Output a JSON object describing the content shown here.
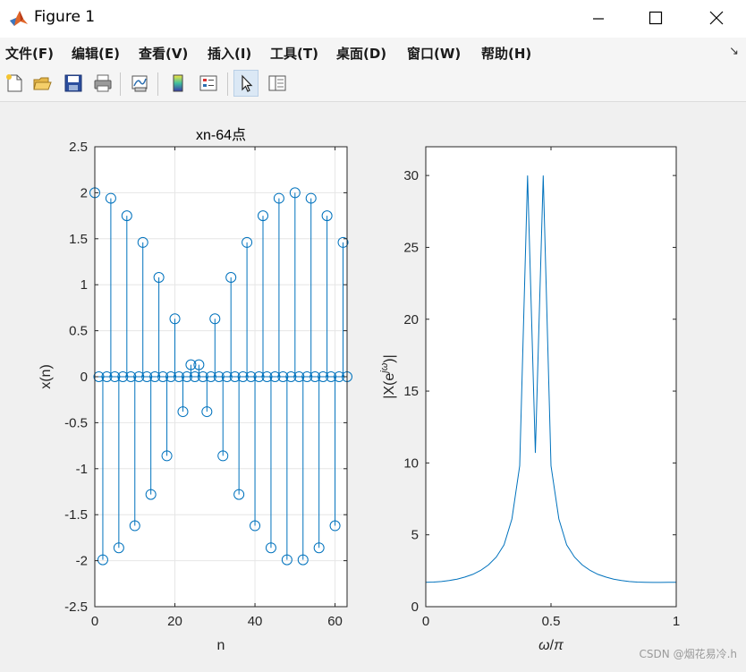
{
  "window": {
    "title": "Figure 1"
  },
  "menu": [
    "文件(F)",
    "编辑(E)",
    "查看(V)",
    "插入(I)",
    "工具(T)",
    "桌面(D)",
    "窗口(W)",
    "帮助(H)"
  ],
  "toolbar": [
    {
      "icon": "new-file-icon"
    },
    {
      "icon": "open-folder-icon"
    },
    {
      "icon": "save-icon"
    },
    {
      "icon": "print-icon"
    },
    {
      "icon": "link-plot-icon"
    },
    {
      "icon": "colorbar-icon"
    },
    {
      "icon": "legend-icon"
    },
    {
      "icon": "pointer-icon",
      "active": true
    },
    {
      "icon": "property-editor-icon"
    }
  ],
  "colors": {
    "series": "#0072bd",
    "grid": "#e6e6e6",
    "axes": "#262626"
  },
  "chart_data": [
    {
      "type": "scatter",
      "style": "stem",
      "title": "xn-64点",
      "xlabel": "n",
      "ylabel": "x(n)",
      "xlim": [
        0,
        63
      ],
      "ylim": [
        -2.5,
        2.5
      ],
      "xticks": [
        0,
        20,
        40,
        60
      ],
      "yticks": [
        -2.5,
        -2,
        -1.5,
        -1,
        -0.5,
        0,
        0.5,
        1,
        1.5,
        2,
        2.5
      ],
      "grid": true,
      "x": [
        0,
        1,
        2,
        3,
        4,
        5,
        6,
        7,
        8,
        9,
        10,
        11,
        12,
        13,
        14,
        15,
        16,
        17,
        18,
        19,
        20,
        21,
        22,
        23,
        24,
        25,
        26,
        27,
        28,
        29,
        30,
        31,
        32,
        33,
        34,
        35,
        36,
        37,
        38,
        39,
        40,
        41,
        42,
        43,
        44,
        45,
        46,
        47,
        48,
        49,
        50,
        51,
        52,
        53,
        54,
        55,
        56,
        57,
        58,
        59,
        60,
        61,
        62,
        63
      ],
      "y": [
        2,
        0,
        -1.99,
        0,
        1.94,
        0,
        -1.86,
        0,
        1.75,
        0,
        -1.62,
        0,
        1.46,
        0,
        -1.28,
        0,
        1.08,
        0,
        -0.86,
        0,
        0.63,
        0,
        -0.38,
        0,
        0.13,
        0,
        0.13,
        0,
        -0.38,
        0,
        0.63,
        0,
        -0.86,
        0,
        1.08,
        0,
        -1.28,
        0,
        1.46,
        0,
        -1.62,
        0,
        1.75,
        0,
        -1.86,
        0,
        1.94,
        0,
        -1.99,
        0,
        2,
        0,
        -1.99,
        0,
        1.94,
        0,
        -1.86,
        0,
        1.75,
        0,
        -1.62,
        0,
        1.46,
        0
      ]
    },
    {
      "type": "line",
      "title": "",
      "xlabel": "ω/π",
      "ylabel": "|X(e^{jω})|",
      "xlim": [
        0,
        1
      ],
      "ylim": [
        0,
        32
      ],
      "xticks": [
        0,
        0.5,
        1
      ],
      "yticks": [
        0,
        5,
        10,
        15,
        20,
        25,
        30
      ],
      "grid": false,
      "x": [
        0,
        0.03125,
        0.0625,
        0.09375,
        0.125,
        0.15625,
        0.1875,
        0.21875,
        0.25,
        0.28125,
        0.3125,
        0.34375,
        0.375,
        0.40625,
        0.4375,
        0.46875,
        0.5,
        0.53125,
        0.5625,
        0.59375,
        0.625,
        0.65625,
        0.6875,
        0.71875,
        0.75,
        0.78125,
        0.8125,
        0.84375,
        0.875,
        0.90625,
        0.9375,
        0.96875,
        1
      ],
      "y": [
        1.7,
        1.71,
        1.75,
        1.82,
        1.92,
        2.06,
        2.25,
        2.52,
        2.9,
        3.45,
        4.3,
        6.1,
        9.8,
        30,
        10.7,
        30,
        9.8,
        6.1,
        4.3,
        3.45,
        2.9,
        2.52,
        2.25,
        2.06,
        1.92,
        1.82,
        1.75,
        1.71,
        1.7,
        1.69,
        1.69,
        1.7,
        1.7
      ]
    }
  ],
  "watermark": "CSDN @烟花易冷.h"
}
